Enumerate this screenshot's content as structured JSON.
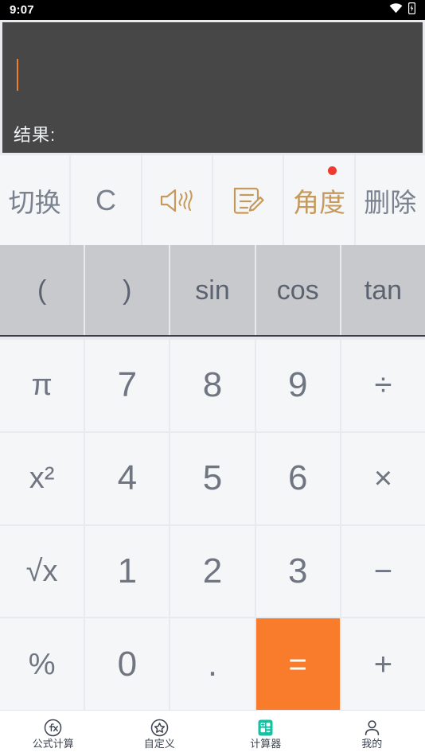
{
  "statusbar": {
    "time": "9:07",
    "wifi_icon": "wifi-icon",
    "battery_icon": "battery-charging-icon"
  },
  "display": {
    "expression": "",
    "result_label": "结果:",
    "result_value": "",
    "background_color": "#474747",
    "caret_color": "#ef7f29"
  },
  "function_row": [
    {
      "label": "切换",
      "name": "switch-button",
      "kind": "text",
      "color": "#7a8290"
    },
    {
      "label": "C",
      "name": "clear-button",
      "kind": "text",
      "color": "#7a8290"
    },
    {
      "label": "",
      "name": "sound-button",
      "kind": "icon",
      "icon": "speaker-sound-icon",
      "color": "#c59a5c"
    },
    {
      "label": "",
      "name": "note-button",
      "kind": "icon",
      "icon": "note-edit-icon",
      "color": "#c59a5c"
    },
    {
      "label": "角度",
      "name": "angle-unit-button",
      "kind": "text",
      "color": "#c59a5c",
      "badge": true
    },
    {
      "label": "删除",
      "name": "delete-button",
      "kind": "text",
      "color": "#7a8290"
    }
  ],
  "keypad": {
    "trig_row": [
      {
        "label": "(",
        "name": "key-open-paren"
      },
      {
        "label": ")",
        "name": "key-close-paren"
      },
      {
        "label": "sin",
        "name": "key-sin"
      },
      {
        "label": "cos",
        "name": "key-cos"
      },
      {
        "label": "tan",
        "name": "key-tan"
      }
    ],
    "rows": [
      [
        {
          "label": "π",
          "name": "key-pi"
        },
        {
          "label": "7",
          "name": "key-7"
        },
        {
          "label": "8",
          "name": "key-8"
        },
        {
          "label": "9",
          "name": "key-9"
        },
        {
          "label": "÷",
          "name": "key-divide"
        }
      ],
      [
        {
          "label": "x²",
          "name": "key-square"
        },
        {
          "label": "4",
          "name": "key-4"
        },
        {
          "label": "5",
          "name": "key-5"
        },
        {
          "label": "6",
          "name": "key-6"
        },
        {
          "label": "×",
          "name": "key-multiply"
        }
      ],
      [
        {
          "label": "√x",
          "name": "key-sqrt"
        },
        {
          "label": "1",
          "name": "key-1"
        },
        {
          "label": "2",
          "name": "key-2"
        },
        {
          "label": "3",
          "name": "key-3"
        },
        {
          "label": "−",
          "name": "key-subtract"
        }
      ],
      [
        {
          "label": "%",
          "name": "key-percent"
        },
        {
          "label": "0",
          "name": "key-0"
        },
        {
          "label": ".",
          "name": "key-decimal"
        },
        {
          "label": "=",
          "name": "key-equals"
        },
        {
          "label": "+",
          "name": "key-add"
        }
      ]
    ],
    "equals_color": "#f97c2d"
  },
  "bottom_nav": {
    "active_index": 2,
    "active_color": "#0fc4a3",
    "items": [
      {
        "label": "公式计算",
        "icon": "fx-circle-icon",
        "name": "nav-formula"
      },
      {
        "label": "自定义",
        "icon": "star-circle-icon",
        "name": "nav-custom"
      },
      {
        "label": "计算器",
        "icon": "calculator-icon",
        "name": "nav-calculator"
      },
      {
        "label": "我的",
        "icon": "person-icon",
        "name": "nav-profile"
      }
    ]
  }
}
